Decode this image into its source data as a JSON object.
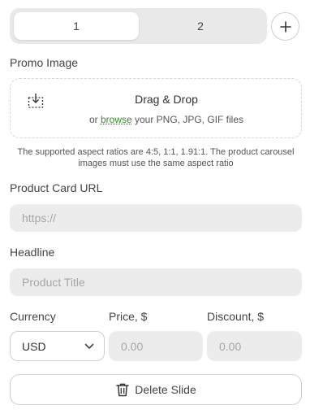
{
  "slides": {
    "tabs": [
      {
        "label": "1",
        "active": true
      },
      {
        "label": "2",
        "active": false
      }
    ],
    "add_icon": "plus-icon"
  },
  "promo_image": {
    "label": "Promo Image",
    "drop_title": "Drag & Drop",
    "drop_prefix": "or ",
    "browse_link": "browse",
    "drop_suffix": " your PNG, JPG, GIF files",
    "icon": "download-icon",
    "hint": "The supported aspect ratios are 4:5, 1:1, 1.91:1. The product carousel images must use the same aspect ratio"
  },
  "product_card_url": {
    "label": "Product Card URL",
    "placeholder": "https://"
  },
  "headline": {
    "label": "Headline",
    "placeholder": "Product Title"
  },
  "currency": {
    "label": "Currency",
    "value": "USD",
    "icon": "chevron-down-icon"
  },
  "price": {
    "label": "Price, $",
    "placeholder": "0.00"
  },
  "discount": {
    "label": "Discount, $",
    "placeholder": "0.00"
  },
  "delete_button": {
    "label": "Delete Slide",
    "icon": "trash-icon"
  },
  "colors": {
    "link": "#3a8a2c",
    "input_bg": "#ececec",
    "segment_bg": "#e9e9e9"
  }
}
